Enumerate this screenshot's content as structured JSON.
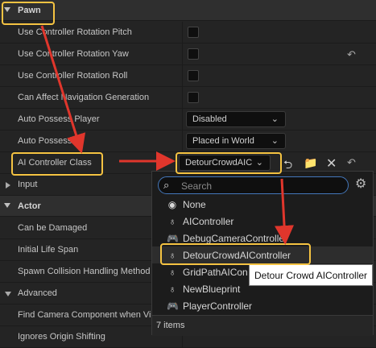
{
  "categories": {
    "pawn": "Pawn",
    "input": "Input",
    "actor": "Actor",
    "advanced": "Advanced"
  },
  "pawn_rows": {
    "use_pitch": "Use Controller Rotation Pitch",
    "use_yaw": "Use Controller Rotation Yaw",
    "use_roll": "Use Controller Rotation Roll",
    "can_affect_nav": "Can Affect Navigation Generation",
    "auto_possess_player": "Auto Possess Player",
    "auto_possess_ai": "Auto Possess AI",
    "ai_controller_class": "AI Controller Class"
  },
  "values": {
    "auto_possess_player": "Disabled",
    "auto_possess_ai": "Placed in World",
    "ai_controller_class": "DetourCrowdAIC"
  },
  "actor_rows": {
    "can_be_damaged": "Can be Damaged",
    "initial_life_span": "Initial Life Span",
    "spawn_collision": "Spawn Collision Handling Method"
  },
  "advanced_rows": {
    "find_camera": "Find Camera Component when View Target",
    "ignore_origin": "Ignores Origin Shifting"
  },
  "picker": {
    "search_placeholder": "Search",
    "items": [
      {
        "label": "None",
        "icon": "circle-icon"
      },
      {
        "label": "AIController",
        "icon": "controller-icon"
      },
      {
        "label": "DebugCameraController",
        "icon": "gamepad-icon"
      },
      {
        "label": "DetourCrowdAIController",
        "icon": "controller-icon"
      },
      {
        "label": "GridPathAIController",
        "icon": "controller-icon"
      },
      {
        "label": "NewBlueprint",
        "icon": "controller-icon"
      },
      {
        "label": "PlayerController",
        "icon": "gamepad-icon"
      }
    ],
    "count": "7 items"
  },
  "tooltip": "Detour Crowd AIController",
  "colors": {
    "highlight": "#f5c342",
    "annotation_arrow": "#e0362c",
    "search_border": "#4477ba"
  }
}
